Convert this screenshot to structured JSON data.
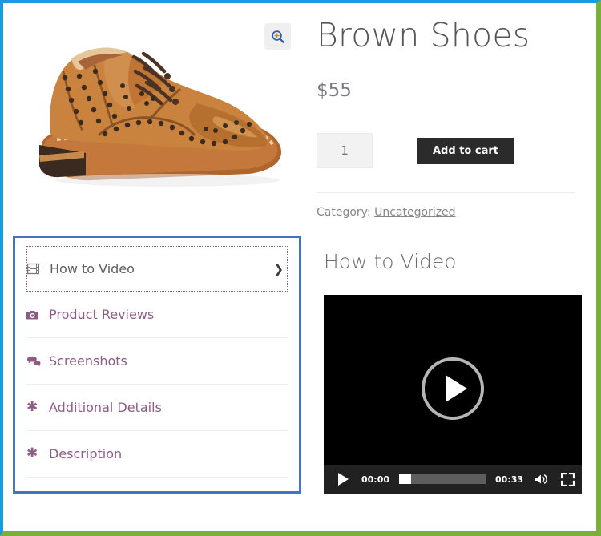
{
  "product": {
    "title": "Brown Shoes",
    "price": "$55",
    "quantity_value": "1",
    "quantity_placeholder": "1",
    "add_to_cart_label": "Add to cart",
    "category_prefix": "Category:",
    "category_link": "Uncategorized",
    "zoom_icon": "zoom-in-magnifier-icon",
    "image_alt": "brown leather brogue shoe"
  },
  "tabs": {
    "border_color": "#4573c4",
    "link_color": "#8f5b85",
    "active_color": "#5e5e63",
    "items": [
      {
        "label": "How to Video",
        "icon": "film-strip-icon",
        "icon_glyph": "",
        "active": true,
        "chevron": "❯"
      },
      {
        "label": "Product Reviews",
        "icon": "camera-icon",
        "icon_glyph": "",
        "active": false
      },
      {
        "label": "Screenshots",
        "icon": "comments-icon",
        "icon_glyph": "",
        "active": false
      },
      {
        "label": "Additional Details",
        "icon": "asterisk-icon",
        "icon_glyph": "✱",
        "active": false
      },
      {
        "label": "Description",
        "icon": "asterisk-icon",
        "icon_glyph": "✱",
        "active": false
      }
    ]
  },
  "video": {
    "heading": "How to Video",
    "current_time": "00:00",
    "duration": "00:33",
    "progress_percent": 14,
    "play_icon": "play-icon",
    "volume_icon": "volume-icon",
    "fullscreen_icon": "fullscreen-icon",
    "big_play_icon": "big-play-icon"
  },
  "frame": {
    "top_border_color": "#1a9be0",
    "left_border_color": "#1a9be0",
    "right_border_color": "#7ab03a",
    "bottom_border_color": "#7ab03a"
  }
}
